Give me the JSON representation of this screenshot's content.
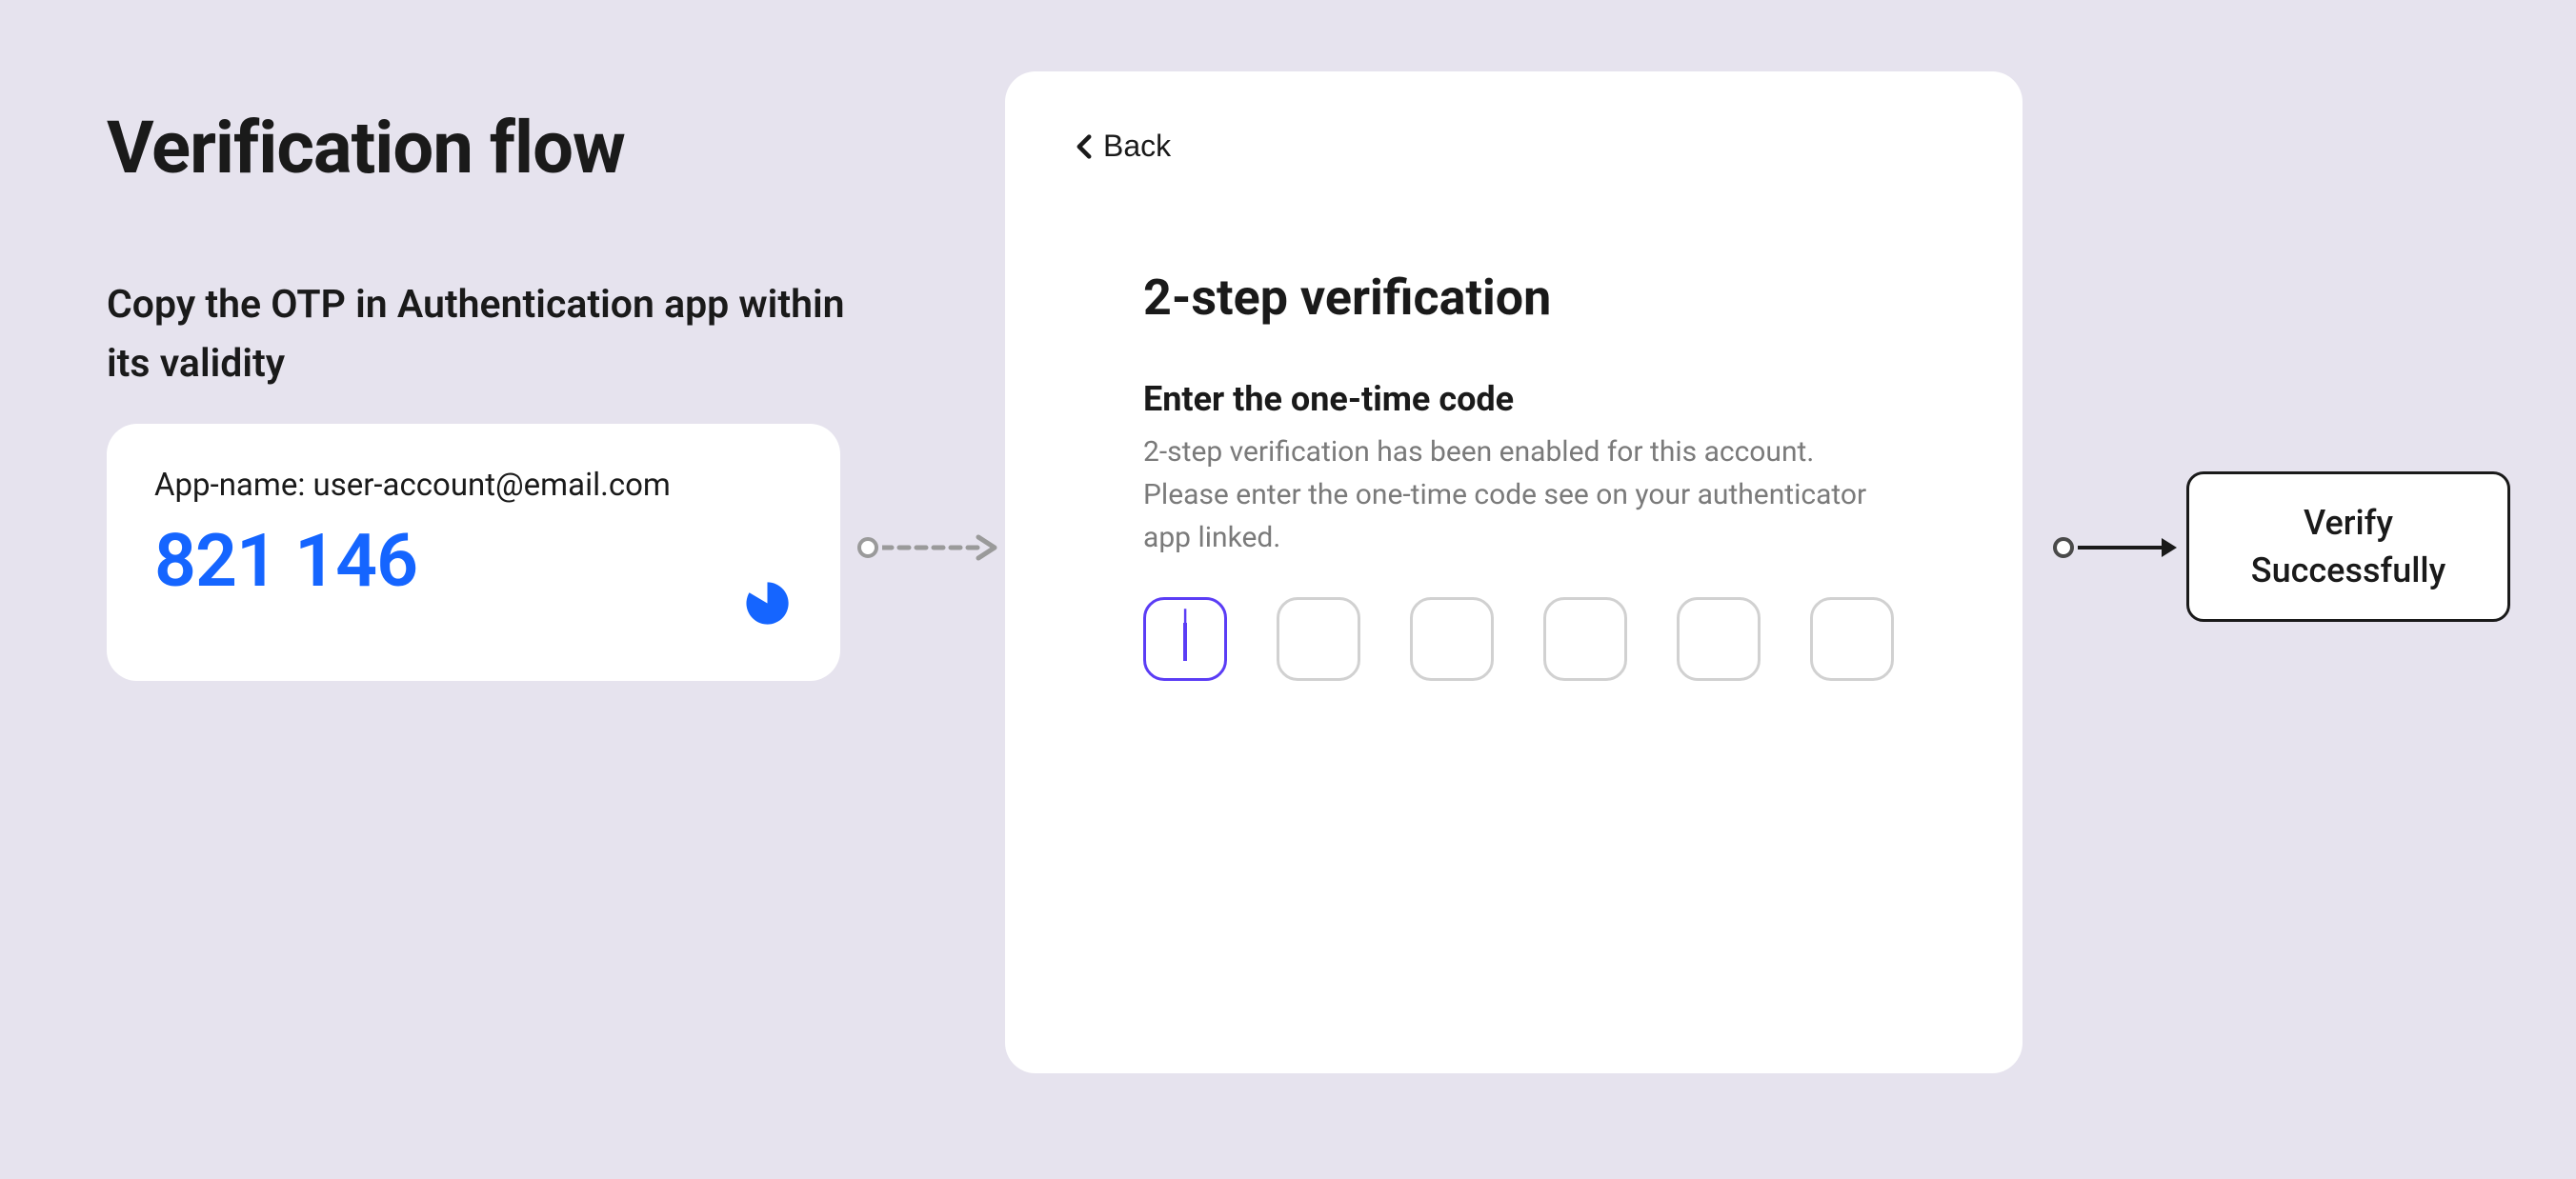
{
  "header": {
    "title": "Verification flow",
    "subtitle": "Copy the OTP in Authentication app within its validity"
  },
  "otp_card": {
    "account_label": "App-name: user-account@email.com",
    "code": "821 146",
    "timer_remaining_fraction": 0.7
  },
  "verification_card": {
    "back_label": "Back",
    "heading": "2-step verification",
    "subheading": "Enter the one-time code",
    "description": "2-step verification has been enabled for this account. Please enter the one-time code see on your authenticator app linked.",
    "inputs": [
      "",
      "",
      "",
      "",
      "",
      ""
    ],
    "active_index": 0
  },
  "success": {
    "line1": "Verify",
    "line2": "Successfully"
  }
}
